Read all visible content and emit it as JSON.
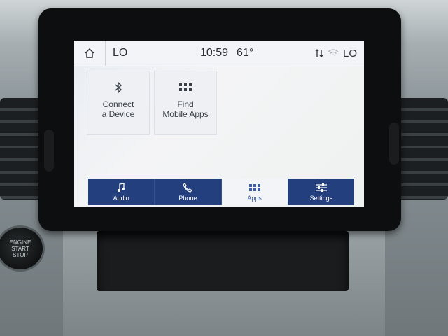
{
  "status_bar": {
    "home_icon": "home-icon",
    "left_temp": "LO",
    "time": "10:59",
    "outside_temp": "61°",
    "right_temp": "LO",
    "icons": [
      "transfer-arrows-icon",
      "wifi-icon"
    ]
  },
  "tiles": [
    {
      "label": "Connect\na Device",
      "icon": "bluetooth-icon"
    },
    {
      "label": "Find\nMobile Apps",
      "icon": "apps-grid-icon"
    }
  ],
  "navbar": {
    "items": [
      {
        "label": "Audio",
        "icon": "music-note-icon",
        "active": false
      },
      {
        "label": "Phone",
        "icon": "phone-icon",
        "active": false
      },
      {
        "label": "Apps",
        "icon": "apps-grid-icon",
        "active": true
      },
      {
        "label": "Settings",
        "icon": "sliders-icon",
        "active": false
      }
    ]
  },
  "engine_button": {
    "label": "ENGINE\nSTART\nSTOP"
  },
  "colors": {
    "navbar": "#233f7d",
    "active_tab": "#f2f4f7",
    "active_text": "#3c5ea6"
  }
}
